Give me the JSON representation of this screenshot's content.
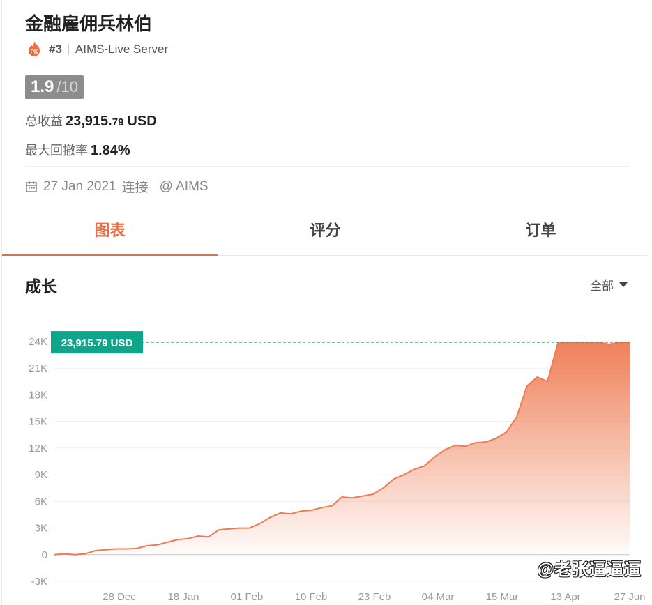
{
  "header": {
    "title": "金融雇佣兵林伯",
    "rank": "#3",
    "server": "AIMS-Live Server",
    "pk_badge": "PK"
  },
  "score": {
    "value": "1.9",
    "max": "/10"
  },
  "stats": {
    "profit_label": "总收益",
    "profit_int": "23,915.",
    "profit_dec": "79",
    "profit_unit": "USD",
    "drawdown_label": "最大回撤率",
    "drawdown_value": "1.84%"
  },
  "connection": {
    "date": "27 Jan 2021",
    "verb": "连接",
    "broker": "@ AIMS"
  },
  "tabs": [
    {
      "label": "图表",
      "active": true
    },
    {
      "label": "评分",
      "active": false
    },
    {
      "label": "订单",
      "active": false
    }
  ],
  "section": {
    "title": "成长",
    "range_label": "全部"
  },
  "colors": {
    "accent": "#ef6c3f",
    "badge": "#0fa58a",
    "line": "#ef7a52"
  },
  "chart_data": {
    "type": "area",
    "current_label": "23,915.79 USD",
    "current_value": 23915.79,
    "y_ticks": [
      "-3K",
      "0",
      "3K",
      "6K",
      "9K",
      "12K",
      "15K",
      "18K",
      "21K",
      "24K"
    ],
    "y_tick_values": [
      -3000,
      0,
      3000,
      6000,
      9000,
      12000,
      15000,
      18000,
      21000,
      24000
    ],
    "x_ticks": [
      "28 Dec",
      "18 Jan",
      "01 Feb",
      "10 Feb",
      "23 Feb",
      "04 Mar",
      "15 Mar",
      "13 Apr",
      "27 Jun"
    ],
    "ylim": [
      -3000,
      24000
    ],
    "grid": true,
    "values": [
      0,
      100,
      0,
      100,
      450,
      550,
      650,
      650,
      700,
      1000,
      1100,
      1400,
      1700,
      1800,
      2100,
      2000,
      2800,
      2900,
      3000,
      3000,
      3500,
      4200,
      4700,
      4600,
      4900,
      5000,
      5300,
      5500,
      6500,
      6400,
      6600,
      6800,
      7500,
      8500,
      9000,
      9600,
      10000,
      11000,
      11800,
      12300,
      12200,
      12600,
      12700,
      13100,
      13800,
      15500,
      19000,
      20000,
      19500,
      23800,
      23900,
      23900,
      23850,
      23900,
      23700,
      23900,
      23915.79
    ]
  },
  "watermark": "@老张逼逼逼"
}
